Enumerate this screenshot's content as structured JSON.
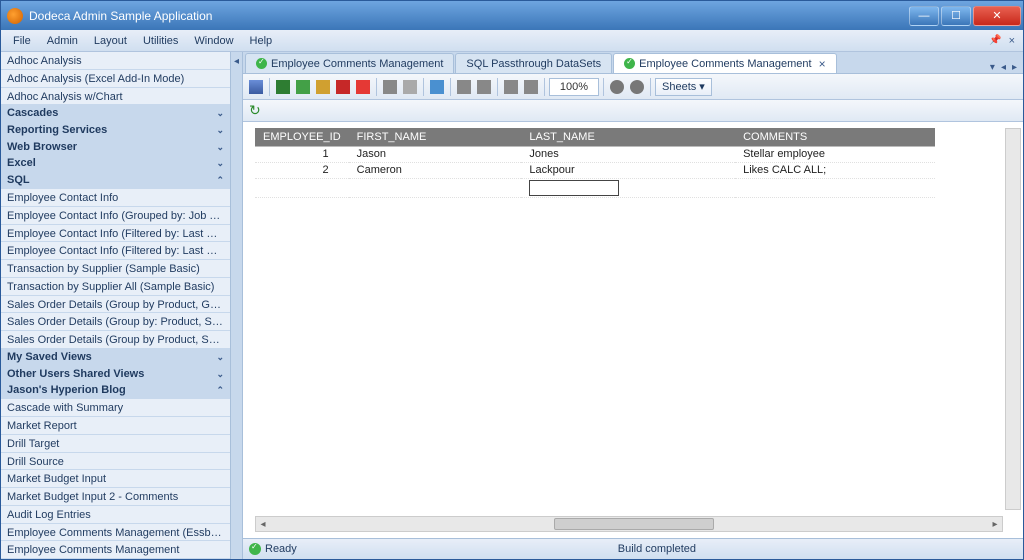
{
  "window": {
    "title": "Dodeca Admin Sample Application"
  },
  "menu": {
    "items": [
      "File",
      "Admin",
      "Layout",
      "Utilities",
      "Window",
      "Help"
    ]
  },
  "sidebar": {
    "adhoc": [
      "Adhoc Analysis",
      "Adhoc Analysis (Excel Add-In Mode)",
      "Adhoc Analysis w/Chart"
    ],
    "headers": {
      "cascades": "Cascades",
      "reporting": "Reporting Services",
      "webbrowser": "Web Browser",
      "excel": "Excel",
      "sql": "SQL",
      "mysaved": "My Saved Views",
      "othershared": "Other Users Shared Views",
      "blog": "Jason's Hyperion Blog"
    },
    "sql": [
      "Employee Contact Info",
      "Employee Contact Info (Grouped by: Job Title)",
      "Employee Contact Info (Filtered by: Last Name)",
      "Employee Contact Info (Filtered by: Last Name, Group...",
      "Transaction by Supplier (Sample Basic)",
      "Transaction by Supplier All (Sample Basic)",
      "Sales Order Details (Group by Product, Group by Sales...",
      "Sales Order Details (Group by: Product, SubGroup by:...",
      "Sales Order Details (Group by Product, SubGroup by U..."
    ],
    "blog": [
      "Cascade with Summary",
      "Market Report",
      "Drill Target",
      "Drill Source",
      "Market Budget Input",
      "Market Budget Input 2 - Comments",
      "Audit Log Entries",
      "Employee Comments Management (Essbase View)",
      "Employee Comments Management"
    ]
  },
  "tabs": [
    {
      "label": "Employee Comments Management",
      "active": false,
      "icon": true
    },
    {
      "label": "SQL Passthrough DataSets",
      "active": false,
      "icon": false
    },
    {
      "label": "Employee Comments Management",
      "active": true,
      "icon": true
    }
  ],
  "toolbar": {
    "zoom": "100%",
    "sheets": "Sheets"
  },
  "table": {
    "columns": [
      "EMPLOYEE_ID",
      "FIRST_NAME",
      "LAST_NAME",
      "COMMENTS"
    ],
    "rows": [
      {
        "id": "1",
        "first": "Jason",
        "last": "Jones",
        "comments": "Stellar employee"
      },
      {
        "id": "2",
        "first": "Cameron",
        "last": "Lackpour",
        "comments": "Likes CALC ALL;"
      }
    ]
  },
  "status": {
    "ready": "Ready",
    "build": "Build completed"
  }
}
